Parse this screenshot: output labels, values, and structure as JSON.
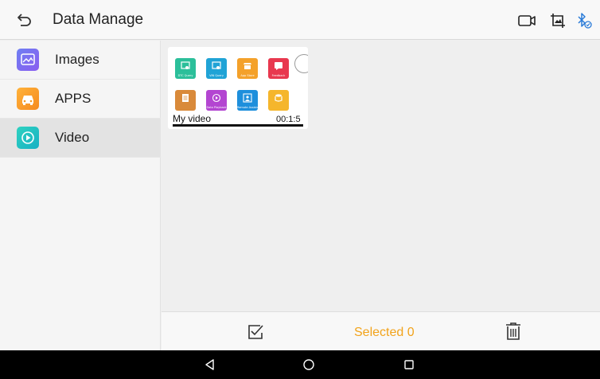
{
  "header": {
    "title": "Data Manage",
    "icons": [
      "back-arrow-icon",
      "video-camera-icon",
      "screenshot-crop-icon",
      "bluetooth-icon"
    ],
    "bluetooth_color": "#2a7bd8"
  },
  "sidebar": {
    "items": [
      {
        "label": "Images",
        "icon": "images-icon",
        "active": false
      },
      {
        "label": "APPS",
        "icon": "apps-car-icon",
        "active": false
      },
      {
        "label": "Video",
        "icon": "video-play-icon",
        "active": true
      }
    ]
  },
  "videos": [
    {
      "name": "My video",
      "duration": "00:1:5",
      "selected": false,
      "thumbnail_tiles": [
        {
          "caption": "DTC Query",
          "color": "#2bbf9a"
        },
        {
          "caption": "VIN Query",
          "color": "#20a3d6"
        },
        {
          "caption": "App Store",
          "color": "#f4a12a"
        },
        {
          "caption": "Feedback",
          "color": "#e8384f"
        },
        {
          "caption": "",
          "color": "#d98a3a"
        },
        {
          "caption": "Data Playback",
          "color": "#b345d1"
        },
        {
          "caption": "Remote Assistance",
          "color": "#1e8fdc"
        },
        {
          "caption": "",
          "color": "#f5b62c"
        }
      ]
    }
  ],
  "footer": {
    "selected_label": "Selected 0",
    "accent_color": "#f2a31b",
    "icons": [
      "select-all-checkbox-icon",
      "trash-icon"
    ]
  },
  "system_nav": {
    "icons": [
      "back-triangle-icon",
      "home-circle-icon",
      "recents-square-icon"
    ]
  }
}
